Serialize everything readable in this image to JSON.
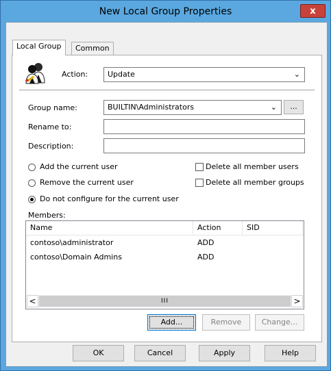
{
  "window": {
    "title": "New Local Group Properties",
    "close_glyph": "x"
  },
  "tabs": [
    {
      "label": "Local Group",
      "active": true
    },
    {
      "label": "Common",
      "active": false
    }
  ],
  "action": {
    "label": "Action:",
    "value": "Update",
    "icon": "users-icon"
  },
  "fields": {
    "group_name": {
      "label": "Group name:",
      "value": "BUILTIN\\Administrators",
      "browse_label": "..."
    },
    "rename_to": {
      "label": "Rename to:",
      "value": ""
    },
    "description": {
      "label": "Description:",
      "value": ""
    }
  },
  "options": {
    "add_current": {
      "label": "Add the current user",
      "checked": false
    },
    "remove_current": {
      "label": "Remove the current user",
      "checked": false
    },
    "do_not_configure": {
      "label": "Do not configure for the current user",
      "checked": true
    },
    "delete_member_users": {
      "label": "Delete all member users",
      "checked": false
    },
    "delete_member_groups": {
      "label": "Delete all member groups",
      "checked": false
    }
  },
  "members": {
    "label": "Members:",
    "columns": [
      "Name",
      "Action",
      "SID"
    ],
    "rows": [
      {
        "name": "contoso\\administrator",
        "action": "ADD",
        "sid": ""
      },
      {
        "name": "contoso\\Domain Admins",
        "action": "ADD",
        "sid": ""
      }
    ],
    "scroll": {
      "left": "<",
      "right": ">",
      "thumb": "III"
    }
  },
  "member_buttons": {
    "add": "Add...",
    "remove": "Remove",
    "change": "Change..."
  },
  "dialog_buttons": {
    "ok": "OK",
    "cancel": "Cancel",
    "apply": "Apply",
    "help": "Help"
  }
}
